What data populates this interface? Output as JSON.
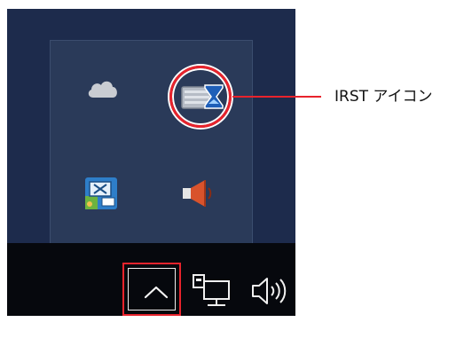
{
  "callout": {
    "label": "IRST アイコン"
  },
  "tray": {
    "icons": [
      "cloud-icon",
      "irst-icon",
      "app-icon",
      "speaker-icon"
    ]
  },
  "taskbar": {
    "icons": [
      "chevron-up-icon",
      "network-icon",
      "volume-icon"
    ]
  },
  "colors": {
    "highlight": "#e8232c",
    "desktop": "#1d2b4c",
    "flyout": "#2a3a59",
    "taskbar": "#06080d"
  }
}
